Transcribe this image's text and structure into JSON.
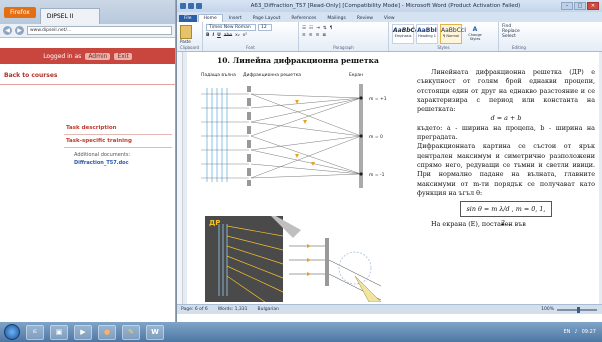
{
  "browser": {
    "app_button": "Firefox",
    "tab_title": "DIPSEL II",
    "url": "www.dipseil.net/...",
    "login_text": "Logged in as",
    "login_user": "Admin",
    "logout": "Exit",
    "back_link": "Back to courses",
    "tasks": [
      {
        "label": "Task description"
      },
      {
        "label": "Task-specific training"
      }
    ],
    "additional_docs_label": "Additional documents:",
    "additional_doc_file": "Diffraction_T57.doc"
  },
  "word": {
    "title": "A63_Diffraction_T57 [Read-Only] [Compatibility Mode] - Microsoft Word (Product Activation Failed)",
    "window_controls": [
      "–",
      "□",
      "✕"
    ],
    "tabs": [
      "File",
      "Home",
      "Insert",
      "Page Layout",
      "References",
      "Mailings",
      "Review",
      "View"
    ],
    "active_tab": "Home",
    "ribbon": {
      "paste": "Paste",
      "font_name": "Times New Roman",
      "font_size": "12",
      "format_buttons": [
        "B",
        "I",
        "U",
        "abe",
        "x₂",
        "x²"
      ],
      "group_labels": [
        "Clipboard",
        "Font",
        "Paragraph",
        "Styles",
        "Editing"
      ],
      "styles": [
        {
          "sample": "AaBbCcI",
          "name": "Emphasis"
        },
        {
          "sample": "AaBbI",
          "name": "Heading 1"
        },
        {
          "sample": "AaBbCcI",
          "name": "¶ Normal"
        }
      ],
      "change_styles": "Change Styles",
      "editing": [
        "Find",
        "Replace",
        "Select"
      ]
    },
    "heading": "10. Линейна дифракционна решетка",
    "figure_labels": {
      "falling_wave": "Падаща вълна",
      "grating": "Дифракционна решетка",
      "screen": "Екран",
      "m_plus": "m = +1",
      "m_zero": "m = 0",
      "m_minus": "m = -1"
    },
    "body": {
      "p1": "Линейната дифракционна решетка (ДР) е съвкупност от голям брой еднакви процепи, отстоящи един от друг на еднакво разстояние и се характеризира с период или константа на решетката:",
      "formula1": "d = a + b",
      "p2": "където: a - ширина на процепа, b - ширина на преградата.",
      "p3": "Дифракционната картина се състои от ярък централен максимум и симетрично разположени спрямо него, редуващи се тъмни и светли ивици. При нормално падане на вълната, главните максимуми от m-ти порядък се получават като функция на ъгъл θ:",
      "formula2": "sin θ = m λ/d ,  m = 0, 1, 2...",
      "p4": "На екрана (Е), поставен във"
    },
    "status": {
      "page": "Page: 6 of 6",
      "words": "Words: 1,331",
      "language": "Bulgarian",
      "zoom": "100%",
      "zoom_level": 0.5
    }
  },
  "taskbar": {
    "apps": [
      "IE",
      "Explorer",
      "Media",
      "Firefox",
      "Paint",
      "Word"
    ],
    "tray_time": "09:27",
    "tray_lang": "EN"
  },
  "colors": {
    "accent_red": "#c8463e",
    "word_blue": "#2a5ea8",
    "firefox_orange": "#e46f12"
  }
}
